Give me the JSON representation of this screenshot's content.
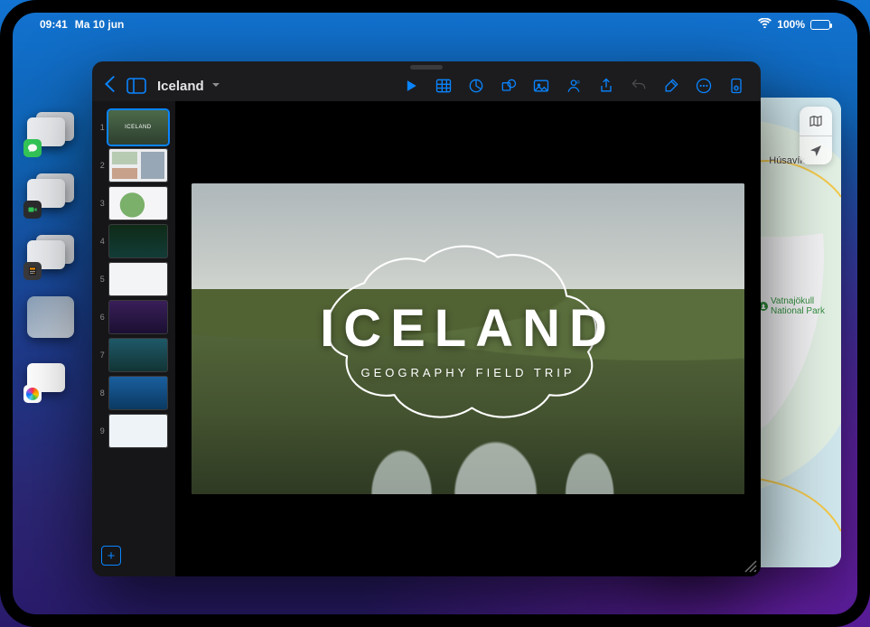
{
  "statusbar": {
    "time": "09:41",
    "date": "Ma 10 jun",
    "battery_pct": "100%",
    "battery_fill_pct": 100
  },
  "stage_apps": {
    "messages": "messages",
    "facetime": "facetime",
    "calculator": "calculator",
    "photos_dog": "photos-preview",
    "photos": "photos"
  },
  "maps": {
    "city_label": "Húsavík",
    "park_label": "Vatnajökull\nNational Park",
    "tool_map": "map-mode",
    "tool_locate": "locate"
  },
  "keynote": {
    "doc_title": "Iceland",
    "back": "back",
    "tools": {
      "play": "play",
      "table": "table",
      "chart": "chart",
      "shape": "shape",
      "image": "image",
      "collab": "collab",
      "share": "share",
      "undo": "undo",
      "format": "format",
      "more": "more",
      "document": "document"
    },
    "slide": {
      "title": "ICELAND",
      "subtitle": "GEOGRAPHY FIELD TRIP"
    },
    "slide_count": 9,
    "selected_slide": 1,
    "add_slide": "add-slide"
  }
}
